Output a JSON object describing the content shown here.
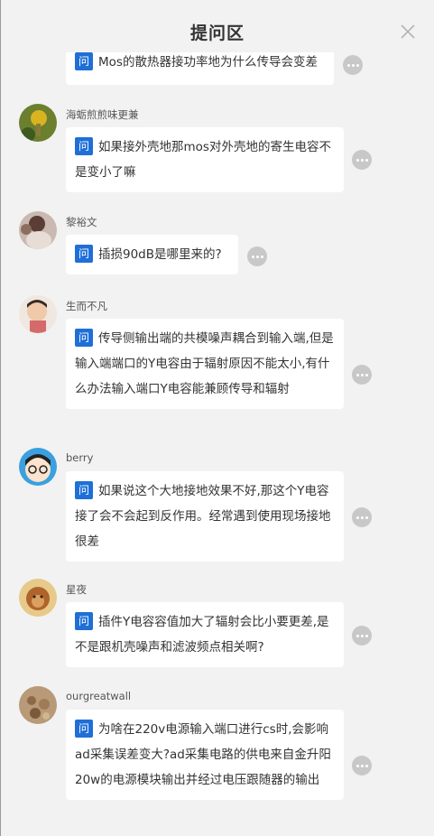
{
  "header": {
    "title": "提问区"
  },
  "badge": "问",
  "questions": [
    {
      "user": "",
      "text": "Mos的散热器接功率地为什么传导会变差"
    },
    {
      "user": "海蛎煎煎味更兼",
      "text": "如果接外壳地那mos对外壳地的寄生电容不是变小了嘛"
    },
    {
      "user": "黎裕文",
      "text": "插损90dB是哪里来的?"
    },
    {
      "user": "生而不凡",
      "text": "传导侧输出端的共模噪声耦合到输入端,但是输入端端口的Y电容由于辐射原因不能太小,有什么办法输入端口Y电容能兼顾传导和辐射"
    },
    {
      "user": "berry",
      "text": "如果说这个大地接地效果不好,那这个Y电容接了会不会起到反作用。经常遇到使用现场接地很差"
    },
    {
      "user": "星夜",
      "text": "插件Y电容容值加大了辐射会比小要更差,是不是跟机壳噪声和滤波频点相关啊?"
    },
    {
      "user": "ourgreatwall",
      "text": "为啥在220v电源输入端口进行cs时,会影响ad采集误差变大?ad采集电路的供电来自金升阳20w的电源模块输出并经过电压跟随器的输出"
    }
  ]
}
